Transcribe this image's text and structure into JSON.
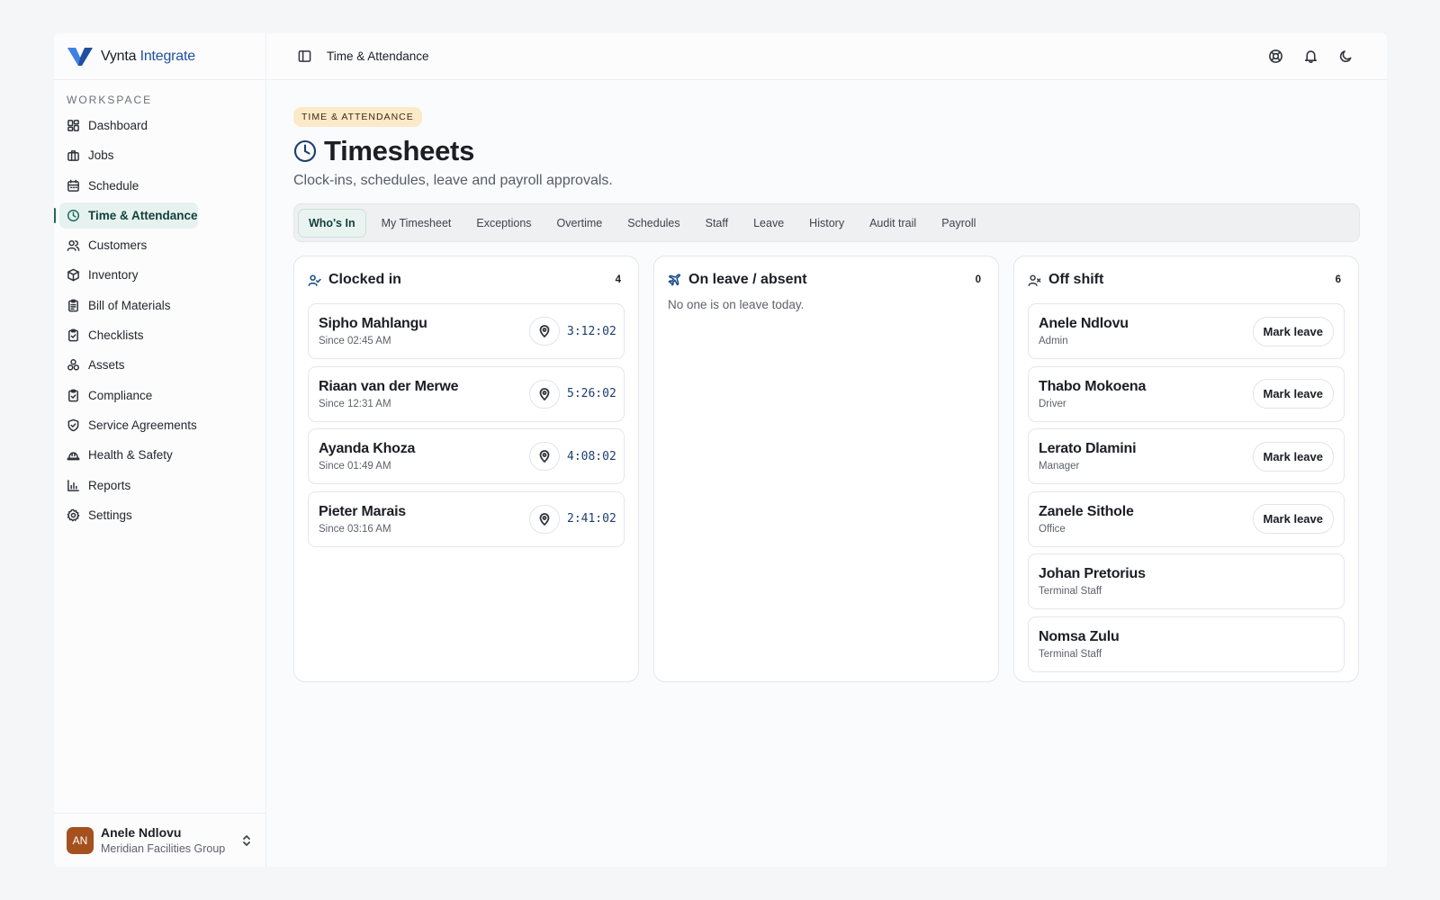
{
  "brand": {
    "name": "Vynta",
    "accent": "Integrate"
  },
  "sidebar": {
    "section_label": "WORKSPACE",
    "items": [
      {
        "label": "Dashboard",
        "icon": "dashboard-icon"
      },
      {
        "label": "Jobs",
        "icon": "briefcase-icon"
      },
      {
        "label": "Schedule",
        "icon": "calendar-icon"
      },
      {
        "label": "Time & Attendance",
        "icon": "clock-icon",
        "active": true
      },
      {
        "label": "Customers",
        "icon": "users-icon"
      },
      {
        "label": "Inventory",
        "icon": "box-icon"
      },
      {
        "label": "Bill of Materials",
        "icon": "clipboard-list-icon"
      },
      {
        "label": "Checklists",
        "icon": "clipboard-check-icon"
      },
      {
        "label": "Assets",
        "icon": "assets-icon"
      },
      {
        "label": "Compliance",
        "icon": "clipboard-check-icon"
      },
      {
        "label": "Service Agreements",
        "icon": "shield-check-icon"
      },
      {
        "label": "Health & Safety",
        "icon": "hard-hat-icon"
      },
      {
        "label": "Reports",
        "icon": "bar-chart-icon"
      },
      {
        "label": "Settings",
        "icon": "gear-icon"
      }
    ],
    "user": {
      "initials": "AN",
      "name": "Anele Ndlovu",
      "org": "Meridian Facilities Group"
    }
  },
  "topbar": {
    "breadcrumb": "Time & Attendance"
  },
  "header": {
    "eyebrow": "TIME & ATTENDANCE",
    "title": "Timesheets",
    "subtitle": "Clock-ins, schedules, leave and payroll approvals."
  },
  "tabs": [
    "Who's In",
    "My Timesheet",
    "Exceptions",
    "Overtime",
    "Schedules",
    "Staff",
    "Leave",
    "History",
    "Audit trail",
    "Payroll"
  ],
  "active_tab": "Who's In",
  "clocked_in": {
    "title": "Clocked in",
    "count": "4",
    "people": [
      {
        "name": "Sipho Mahlangu",
        "since": "Since 02:45 AM",
        "duration": "3:12:02"
      },
      {
        "name": "Riaan van der Merwe",
        "since": "Since 12:31 AM",
        "duration": "5:26:02"
      },
      {
        "name": "Ayanda Khoza",
        "since": "Since 01:49 AM",
        "duration": "4:08:02"
      },
      {
        "name": "Pieter Marais",
        "since": "Since 03:16 AM",
        "duration": "2:41:02"
      }
    ]
  },
  "on_leave": {
    "title": "On leave / absent",
    "count": "0",
    "empty_text": "No one is on leave today."
  },
  "off_shift": {
    "title": "Off shift",
    "count": "6",
    "action_label": "Mark leave",
    "people": [
      {
        "name": "Anele Ndlovu",
        "role": "Admin",
        "action": true
      },
      {
        "name": "Thabo Mokoena",
        "role": "Driver",
        "action": true
      },
      {
        "name": "Lerato Dlamini",
        "role": "Manager",
        "action": true
      },
      {
        "name": "Zanele Sithole",
        "role": "Office",
        "action": true
      },
      {
        "name": "Johan Pretorius",
        "role": "Terminal Staff",
        "action": false
      },
      {
        "name": "Nomsa Zulu",
        "role": "Terminal Staff",
        "action": false
      }
    ]
  },
  "colors": {
    "accent": "#1f6b5e",
    "brand_blue": "#1f4fa0",
    "eyebrow_bg": "#fbe9c7",
    "avatar_bg": "#a4501f"
  }
}
